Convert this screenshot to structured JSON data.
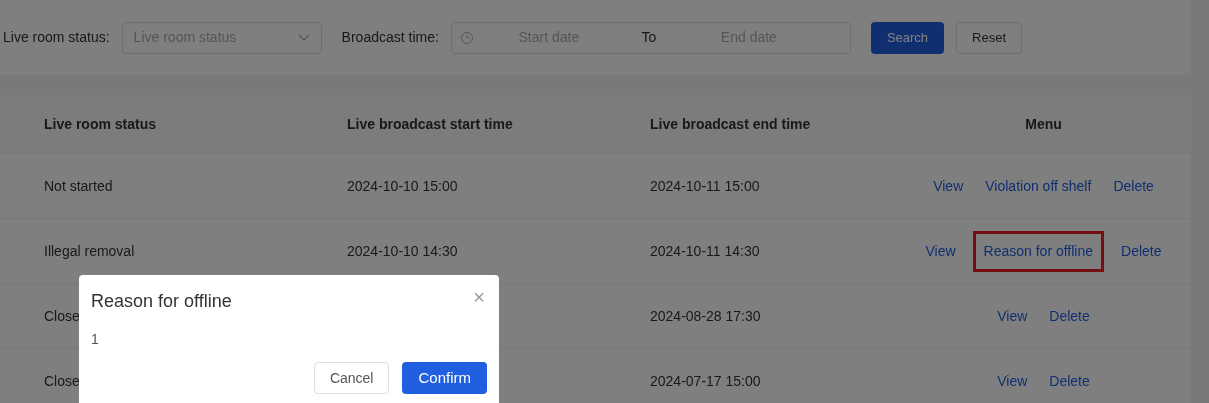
{
  "filters": {
    "status_label": "Live room status:",
    "status_placeholder": "Live room status",
    "time_label": "Broadcast time:",
    "start_placeholder": "Start date",
    "separator": "To",
    "end_placeholder": "End date",
    "search": "Search",
    "reset": "Reset"
  },
  "table": {
    "columns": [
      "Live room status",
      "Live broadcast start time",
      "Live broadcast end time",
      "Menu"
    ],
    "rows": [
      {
        "status": "Not started",
        "start": "2024-10-10 15:00",
        "end": "2024-10-11 15:00",
        "actions": [
          {
            "label": "View",
            "highlighted": false
          },
          {
            "label": "Violation off shelf",
            "highlighted": false
          },
          {
            "label": "Delete",
            "highlighted": false
          }
        ]
      },
      {
        "status": "Illegal removal",
        "start": "2024-10-10 14:30",
        "end": "2024-10-11 14:30",
        "actions": [
          {
            "label": "View",
            "highlighted": false
          },
          {
            "label": "Reason for offline",
            "highlighted": true
          },
          {
            "label": "Delete",
            "highlighted": false
          }
        ]
      },
      {
        "status": "Close",
        "end": "2024-08-28 17:30",
        "actions": [
          {
            "label": "View",
            "highlighted": false
          },
          {
            "label": "Delete",
            "highlighted": false
          }
        ]
      },
      {
        "status": "Close",
        "end": "2024-07-17 15:00",
        "actions": [
          {
            "label": "View",
            "highlighted": false
          },
          {
            "label": "Delete",
            "highlighted": false
          }
        ]
      }
    ]
  },
  "dialog": {
    "title": "Reason for offline",
    "body": "1",
    "close": "×",
    "cancel": "Cancel",
    "confirm": "Confirm"
  }
}
